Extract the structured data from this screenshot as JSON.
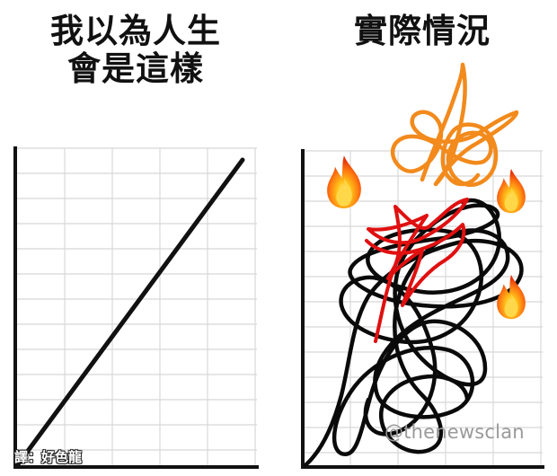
{
  "left_panel": {
    "caption_line1": "我以為人生",
    "caption_line2": "會是這樣"
  },
  "right_panel": {
    "caption": "實際情況"
  },
  "watermark": "@thenewsclan",
  "credit": "譯：好色龍",
  "colors": {
    "grid": "#d8d8d8",
    "axis": "#111111",
    "orange_scribble": "#f28a1c",
    "red_scribble": "#e01010",
    "black_scribble": "#0a0a0a"
  },
  "icons": [
    "fire-emoji-icon"
  ]
}
